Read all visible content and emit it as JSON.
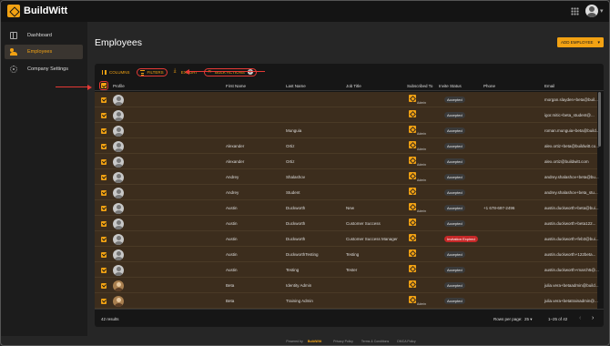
{
  "app": {
    "brand": "BuildWitt"
  },
  "sidebar": {
    "items": [
      {
        "label": "Dashboard",
        "icon": "dashboard-icon"
      },
      {
        "label": "Employees",
        "icon": "users-icon",
        "active": true
      },
      {
        "label": "Company Settings",
        "icon": "gear-icon"
      }
    ]
  },
  "page": {
    "title": "Employees",
    "add_button": "ADD EMPLOYEE"
  },
  "toolbar": {
    "columns": "COLUMNS",
    "filters": "FILTERS",
    "export": "EXPORT",
    "bulk_actions": "BULK ACTIONS",
    "bulk_count": "2"
  },
  "table": {
    "headers": {
      "profile": "Profile",
      "first_name": "First Name",
      "last_name": "Last Name",
      "job_title": "Job Title",
      "subscribed_to": "Subscribed To",
      "invite_status": "Invite Status",
      "phone": "Phone",
      "email": "Email"
    },
    "rows": [
      {
        "first": "",
        "last": "",
        "job": "",
        "admin": "Admin",
        "status": "Accepted",
        "phone": "",
        "email": "morgan.slayden+beta@buil..."
      },
      {
        "first": "",
        "last": "",
        "job": "",
        "admin": "",
        "status": "Accepted",
        "phone": "",
        "email": "igor.mitic+beta_student@..."
      },
      {
        "first": "",
        "last": "Munguia",
        "job": "",
        "admin": "Admin",
        "status": "Accepted",
        "phone": "",
        "email": "roman.munguia+beta@build..."
      },
      {
        "first": "Alexander",
        "last": "Ortiz",
        "job": "",
        "admin": "Admin",
        "status": "Accepted",
        "phone": "",
        "email": "alex.ortiz+beta@buildwitt.co..."
      },
      {
        "first": "Alexander",
        "last": "Ortiz",
        "job": "",
        "admin": "Admin",
        "status": "Accepted",
        "phone": "",
        "email": "alex.ortiz@buildwitt.com"
      },
      {
        "first": "Andrey",
        "last": "Shalashov",
        "job": "",
        "admin": "Admin",
        "status": "Accepted",
        "phone": "",
        "email": "andrey.shalashov+beta@bu..."
      },
      {
        "first": "Andrey",
        "last": "Student",
        "job": "",
        "admin": "",
        "status": "Accepted",
        "phone": "",
        "email": "andrey.shalashov+beta_stu..."
      },
      {
        "first": "Austin",
        "last": "Duckworth",
        "job": "New",
        "admin": "Admin",
        "status": "Accepted",
        "phone": "+1 678-697-2496",
        "email": "austin.duckworth+beta@bui..."
      },
      {
        "first": "Austin",
        "last": "Duckworth",
        "job": "Customer Success",
        "admin": "",
        "status": "Accepted",
        "phone": "",
        "email": "austin.duckworth+beta122..."
      },
      {
        "first": "Austin",
        "last": "Duckworth",
        "job": "Customer Success Manager",
        "admin": "",
        "status": "Invitation Expired",
        "phone": "",
        "email": "austin.duckworth+feb3@bui..."
      },
      {
        "first": "Austin",
        "last": "DuckworthTesting",
        "job": "Testing",
        "admin": "",
        "status": "Accepted",
        "phone": "",
        "email": "austin.duckworth+122beta..."
      },
      {
        "first": "Austin",
        "last": "Testing",
        "job": "Tester",
        "admin": "",
        "status": "Accepted",
        "phone": "",
        "email": "austin.duckworth+march5@..."
      },
      {
        "first": "Beta",
        "last": "Identity Admin",
        "job": "",
        "admin": "",
        "status": "Accepted",
        "phone": "",
        "email": "julia.vera+betaadmin@build..."
      },
      {
        "first": "Beta",
        "last": "Training Admin",
        "job": "",
        "admin": "Admin",
        "status": "Accepted",
        "phone": "",
        "email": "julia.vera+betatrainadmin@..."
      }
    ]
  },
  "pagination": {
    "results": "42 results",
    "rows_per_page_label": "Rows per page:",
    "rows_per_page": "25",
    "range": "1–25 of 42"
  },
  "footer": {
    "powered_by": "Powered by",
    "brand": "BuildWitt",
    "links": [
      "Privacy Policy",
      "Terms & Conditions",
      "DMCA Policy"
    ]
  },
  "colors": {
    "accent": "#f2a213",
    "row_selected": "#3c2d1d",
    "annotation": "#e53935",
    "expired": "#c62828"
  }
}
